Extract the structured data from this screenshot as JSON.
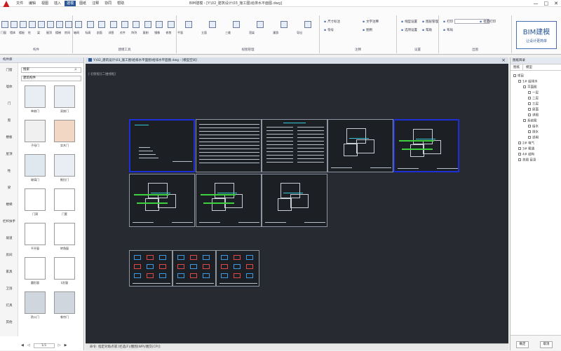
{
  "window": {
    "title": "BIM建模 - [Y:\\02_建筑设计\\03_施工图\\给排水平面图.dwg]",
    "controls": [
      "—",
      "□",
      "✕"
    ]
  },
  "menu": [
    "文件",
    "编辑",
    "视图",
    "插入",
    "建模",
    "图纸",
    "注释",
    "协同",
    "帮助"
  ],
  "menu_active_index": 4,
  "ribbon": {
    "groups": [
      {
        "label": "构件",
        "buttons": [
          "门窗",
          "墙体",
          "楼板",
          "柱",
          "梁",
          "屋顶",
          "楼梯",
          "房间"
        ]
      },
      {
        "label": "建模工具",
        "buttons": [
          "轴网",
          "标高",
          "剖面",
          "详图",
          "对齐",
          "阵列",
          "复制",
          "镜像",
          "修剪"
        ]
      },
      {
        "label": "视图管理",
        "buttons": [
          "平面",
          "立面",
          "三维",
          "渲染",
          "漫游",
          "导出"
        ]
      },
      {
        "label": "注释",
        "small": [
          "尺寸标注",
          "文字注释",
          "符号",
          "图例"
        ]
      },
      {
        "label": "设置",
        "small": [
          "线型设置",
          "图层管理",
          "选项设置",
          "帮助"
        ]
      },
      {
        "label": "出图",
        "small": [
          "打印",
          "批量打印",
          "布局"
        ]
      }
    ],
    "logo_title": "BIM建模",
    "logo_sub": "让设计更简单"
  },
  "left_panel": {
    "header": "构件库",
    "search": "搜索",
    "select": "建筑构件",
    "categories": [
      "门窗",
      "墙体",
      "门",
      "窗",
      "楼板",
      "屋顶",
      "柱",
      "梁",
      "楼梯",
      "栏杆扶手",
      "坡道",
      "房间",
      "家具",
      "卫浴",
      "灯具",
      "其他"
    ],
    "components": [
      {
        "label": "单扇门",
        "color": "#e8eef4"
      },
      {
        "label": "双扇门",
        "color": "#e8eef4"
      },
      {
        "label": "子母门",
        "color": "#f0f0f0"
      },
      {
        "label": "实木门",
        "color": "#f2d7c4"
      },
      {
        "label": "玻璃门",
        "color": "#dfe8ef"
      },
      {
        "label": "推拉门",
        "color": "#e8eef4"
      },
      {
        "label": "门洞",
        "color": "#ffffff"
      },
      {
        "label": "门套",
        "color": "#ffffff"
      },
      {
        "label": "平开窗",
        "color": "#ffffff"
      },
      {
        "label": "转角窗",
        "color": "#ffffff"
      },
      {
        "label": "圆形窗",
        "color": "#ffffff"
      },
      {
        "label": "L形窗",
        "color": "#ffffff"
      },
      {
        "label": "防火门",
        "color": "#cfd6de"
      },
      {
        "label": "卷帘门",
        "color": "#cfd6de"
      }
    ],
    "pager": {
      "first": "◀",
      "prev": "◁",
      "value": "1/1",
      "next": "▷",
      "last": "▶"
    }
  },
  "canvas": {
    "tab_path": "Y:\\02_建筑设计\\03_施工图\\给排水平面图\\给排水平面图.dwg - [模型空间]",
    "crumb": "[-][俯视][二维线框]",
    "status": "命令: 指定对角点或 [栏选(F)/圈围(WP)/圈交(CP)]:"
  },
  "right_panel": {
    "title": "图纸目录",
    "tabs": [
      "图纸",
      "模型"
    ],
    "tree": [
      {
        "label": "项目",
        "depth": 0
      },
      {
        "label": "1# 给排水",
        "depth": 1
      },
      {
        "label": "平面图",
        "depth": 2
      },
      {
        "label": "一层",
        "depth": 3
      },
      {
        "label": "二层",
        "depth": 3
      },
      {
        "label": "三层",
        "depth": 3
      },
      {
        "label": "屋面",
        "depth": 3
      },
      {
        "label": "详图",
        "depth": 3
      },
      {
        "label": "系统图",
        "depth": 2
      },
      {
        "label": "给水",
        "depth": 3
      },
      {
        "label": "排水",
        "depth": 3
      },
      {
        "label": "说明",
        "depth": 3
      },
      {
        "label": "2# 电气",
        "depth": 1
      },
      {
        "label": "3# 暖通",
        "depth": 1
      },
      {
        "label": "4# 结构",
        "depth": 1
      },
      {
        "label": "总图 目录",
        "depth": 1
      }
    ],
    "ok": "确定",
    "cancel": "取消"
  }
}
